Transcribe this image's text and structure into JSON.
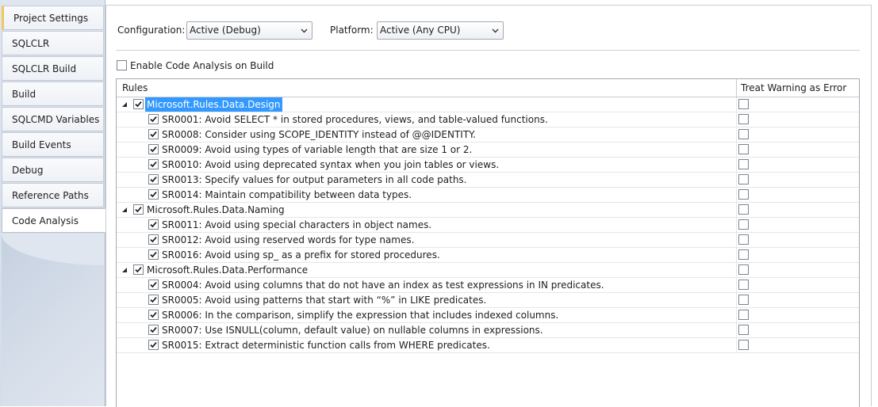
{
  "sidebar": {
    "items": [
      {
        "label": "Project Settings"
      },
      {
        "label": "SQLCLR"
      },
      {
        "label": "SQLCLR Build"
      },
      {
        "label": "Build"
      },
      {
        "label": "SQLCMD Variables"
      },
      {
        "label": "Build Events"
      },
      {
        "label": "Debug"
      },
      {
        "label": "Reference Paths"
      },
      {
        "label": "Code Analysis"
      }
    ],
    "active": "Code Analysis"
  },
  "toolbar": {
    "configuration_label": "Configuration:",
    "configuration_value": "Active (Debug)",
    "platform_label": "Platform:",
    "platform_value": "Active (Any CPU)"
  },
  "enable_code_analysis": {
    "label": "Enable Code Analysis on Build",
    "checked": false
  },
  "grid": {
    "headers": {
      "rules": "Rules",
      "treat_warning": "Treat Warning as Error"
    },
    "rows": [
      {
        "kind": "group",
        "text": "Microsoft.Rules.Data.Design",
        "checked": true,
        "selected": true
      },
      {
        "kind": "child",
        "text": "SR0001: Avoid SELECT * in stored procedures, views, and table-valued functions.",
        "checked": true
      },
      {
        "kind": "child",
        "text": "SR0008: Consider using SCOPE_IDENTITY instead of @@IDENTITY.",
        "checked": true
      },
      {
        "kind": "child",
        "text": "SR0009: Avoid using types of variable length that are size 1 or 2.",
        "checked": true
      },
      {
        "kind": "child",
        "text": "SR0010: Avoid using deprecated syntax when you join tables or views.",
        "checked": true
      },
      {
        "kind": "child",
        "text": "SR0013: Specify values for output parameters in all code paths.",
        "checked": true
      },
      {
        "kind": "child",
        "text": "SR0014: Maintain compatibility between data types.",
        "checked": true
      },
      {
        "kind": "group",
        "text": "Microsoft.Rules.Data.Naming",
        "checked": true
      },
      {
        "kind": "child",
        "text": "SR0011: Avoid using special characters in object names.",
        "checked": true
      },
      {
        "kind": "child",
        "text": "SR0012: Avoid using reserved words for type names.",
        "checked": true
      },
      {
        "kind": "child",
        "text": "SR0016: Avoid using sp_ as a prefix for stored procedures.",
        "checked": true
      },
      {
        "kind": "group",
        "text": "Microsoft.Rules.Data.Performance",
        "checked": true
      },
      {
        "kind": "child",
        "text": "SR0004: Avoid using columns that do not have an index as test expressions in IN predicates.",
        "checked": true
      },
      {
        "kind": "child",
        "text": "SR0005: Avoid using patterns that start with “%” in LIKE predicates.",
        "checked": true
      },
      {
        "kind": "child",
        "text": "SR0006: In the comparison, simplify the expression that includes indexed columns.",
        "checked": true
      },
      {
        "kind": "child",
        "text": "SR0007: Use ISNULL(column, default value) on nullable columns in expressions.",
        "checked": true
      },
      {
        "kind": "child",
        "text": "SR0015: Extract deterministic function calls from WHERE predicates.",
        "checked": true
      }
    ]
  },
  "icons": {
    "dropdown": "chevron-down-icon",
    "expander": "collapse-triangle-icon",
    "check": "checkmark-icon"
  }
}
